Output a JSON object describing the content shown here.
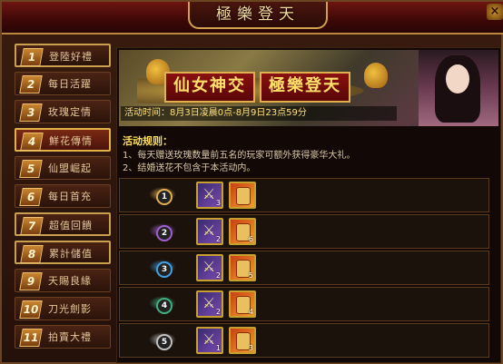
{
  "window": {
    "title": "極樂登天",
    "close_label": "×"
  },
  "sidebar": {
    "items": [
      {
        "num": "1",
        "label": "登陸好禮",
        "state": "hl"
      },
      {
        "num": "2",
        "label": "每日活躍",
        "state": ""
      },
      {
        "num": "3",
        "label": "玫瑰定情",
        "state": ""
      },
      {
        "num": "4",
        "label": "鮮花傳情",
        "state": "active"
      },
      {
        "num": "5",
        "label": "仙盟崛起",
        "state": ""
      },
      {
        "num": "6",
        "label": "每日首充",
        "state": ""
      },
      {
        "num": "7",
        "label": "超值回饋",
        "state": "hl"
      },
      {
        "num": "8",
        "label": "累計儲值",
        "state": "hl"
      },
      {
        "num": "9",
        "label": "天賜良緣",
        "state": ""
      },
      {
        "num": "10",
        "label": "刀光劍影",
        "state": ""
      },
      {
        "num": "11",
        "label": "拍賣大禮",
        "state": ""
      }
    ]
  },
  "banner": {
    "title_left": "仙女神交",
    "title_right": "極樂登天",
    "time_text": "活动时间：8月3日凌晨0点-8月9日23点59分"
  },
  "rules": {
    "heading": "活动规则：",
    "lines": [
      "1、每天赠送玫瑰数量前五名的玩家可额外获得豪华大礼。",
      "2、结婚送花不包含于本活动内。"
    ]
  },
  "rewards": [
    {
      "rank": "1",
      "medal_color": "#e0b050",
      "sword_qty": "3",
      "scroll_qty": ""
    },
    {
      "rank": "2",
      "medal_color": "#a060d0",
      "sword_qty": "2",
      "scroll_qty": "6"
    },
    {
      "rank": "3",
      "medal_color": "#40a0e0",
      "sword_qty": "2",
      "scroll_qty": "5"
    },
    {
      "rank": "4",
      "medal_color": "#40b080",
      "sword_qty": "2",
      "scroll_qty": "4"
    },
    {
      "rank": "5",
      "medal_color": "#c0c0c0",
      "sword_qty": "1",
      "scroll_qty": "3"
    }
  ]
}
